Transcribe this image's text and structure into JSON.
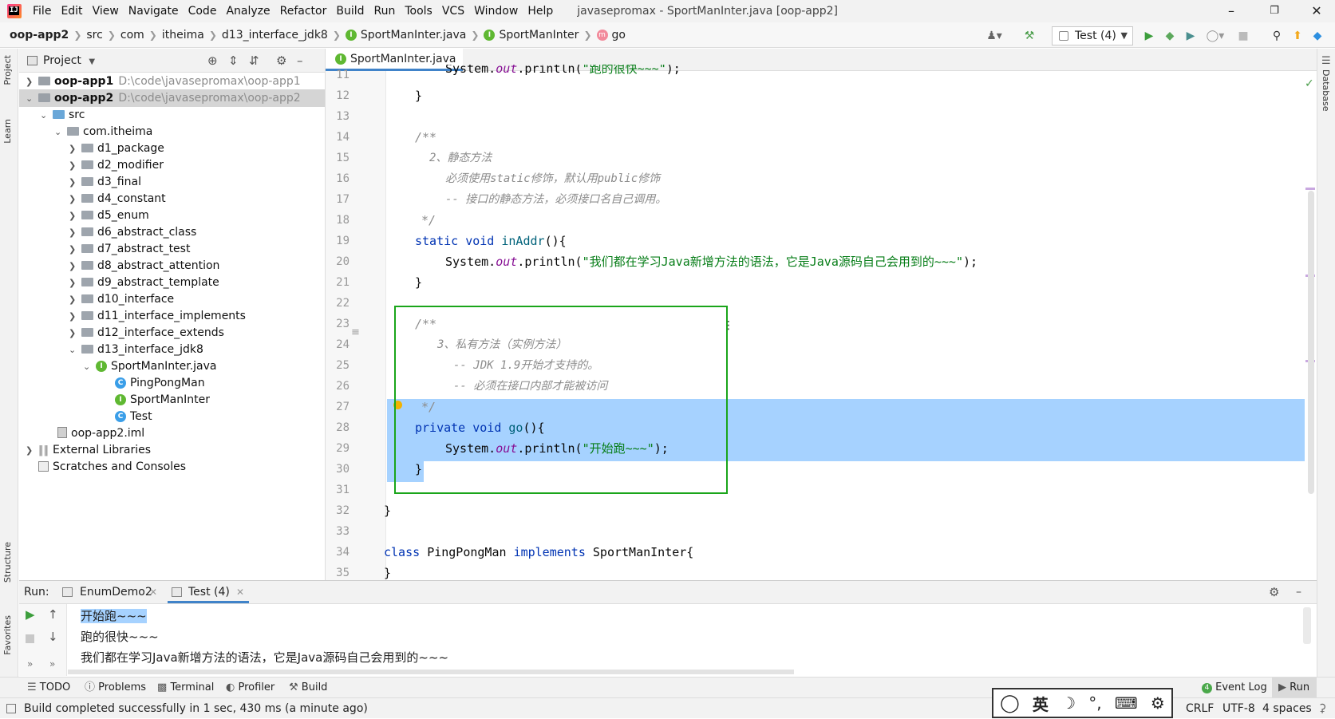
{
  "menubar": {
    "items": [
      "File",
      "Edit",
      "View",
      "Navigate",
      "Code",
      "Analyze",
      "Refactor",
      "Build",
      "Run",
      "Tools",
      "VCS",
      "Window",
      "Help"
    ],
    "title": "javasepromax - SportManInter.java [oop-app2]"
  },
  "navbar": {
    "crumbs": [
      "oop-app2",
      "src",
      "com",
      "itheima",
      "d13_interface_jdk8",
      "SportManInter.java",
      "SportManInter",
      "go"
    ],
    "run_config": "Test (4)"
  },
  "left_strip": {
    "project": "Project",
    "learn": "Learn",
    "structure": "Structure",
    "favorites": "Favorites"
  },
  "right_strip": {
    "database": "Database"
  },
  "project_panel": {
    "title": "Project",
    "nodes": [
      {
        "label": "oop-app1",
        "path": "D:\\code\\javasepromax\\oop-app1"
      },
      {
        "label": "oop-app2",
        "path": "D:\\code\\javasepromax\\oop-app2"
      },
      {
        "label": "src"
      },
      {
        "label": "com.itheima"
      },
      {
        "label": "d1_package"
      },
      {
        "label": "d2_modifier"
      },
      {
        "label": "d3_final"
      },
      {
        "label": "d4_constant"
      },
      {
        "label": "d5_enum"
      },
      {
        "label": "d6_abstract_class"
      },
      {
        "label": "d7_abstract_test"
      },
      {
        "label": "d8_abstract_attention"
      },
      {
        "label": "d9_abstract_template"
      },
      {
        "label": "d10_interface"
      },
      {
        "label": "d11_interface_implements"
      },
      {
        "label": "d12_interface_extends"
      },
      {
        "label": "d13_interface_jdk8"
      },
      {
        "label": "SportManInter.java"
      },
      {
        "label": "PingPongMan"
      },
      {
        "label": "SportManInter"
      },
      {
        "label": "Test"
      },
      {
        "label": "oop-app2.iml"
      },
      {
        "label": "External Libraries"
      },
      {
        "label": "Scratches and Consoles"
      }
    ]
  },
  "editor": {
    "tab": "SportManInter.java",
    "line_numbers": [
      "11",
      "12",
      "13",
      "14",
      "15",
      "16",
      "17",
      "18",
      "19",
      "20",
      "21",
      "22",
      "23",
      "24",
      "25",
      "26",
      "27",
      "28",
      "29",
      "30",
      "31",
      "32",
      "33",
      "34",
      "35"
    ],
    "lines": {
      "l11_a": "System.",
      "l11_b": "out",
      "l11_c": ".println(",
      "l11_d": "\"跑的很快~~~\"",
      "l11_e": ");",
      "l12": "}",
      "l14": "/**",
      "l15": "2、静态方法",
      "l16": "必须使用static修饰，默认用public修饰",
      "l17": "-- 接口的静态方法，必须接口名自己调用。",
      "l18": "*/",
      "l19_a": "static void",
      "l19_b": "inAddr",
      "l19_c": "(){",
      "l20_a": "System.",
      "l20_b": "out",
      "l20_c": ".println(",
      "l20_d": "\"我们都在学习Java新增方法的语法，它是Java源码自己会用到的~~~\"",
      "l20_e": ");",
      "l21": "}",
      "l23": "/**",
      "l24": "3、私有方法（实例方法）",
      "l25": "-- JDK 1.9开始才支持的。",
      "l26": "-- 必须在接口内部才能被访问",
      "l27": "*/",
      "l28_a": "private void",
      "l28_b": "go",
      "l28_c": "(){",
      "l29_a": "System.",
      "l29_b": "out",
      "l29_c": ".println(",
      "l29_d": "\"开始跑~~~\"",
      "l29_e": ");",
      "l30": "}",
      "l32": "}",
      "l34_a": "class",
      "l34_b": "PingPongMan",
      "l34_c": "implements",
      "l34_d": "SportManInter{",
      "l35": "}"
    }
  },
  "run_panel": {
    "label": "Run:",
    "tabs": [
      "EnumDemo2",
      "Test (4)"
    ],
    "output": [
      "开始跑~~~",
      "跑的很快~~~",
      "我们都在学习Java新增方法的语法，它是Java源码自己会用到的~~~"
    ]
  },
  "tool_windows": [
    "TODO",
    "Problems",
    "Terminal",
    "Profiler",
    "Build",
    "Event Log",
    "Run"
  ],
  "event_count": "4",
  "status": {
    "message": "Build completed successfully in 1 sec, 430 ms (a minute ago)",
    "line_sep": "CRLF",
    "encoding": "UTF-8",
    "indent": "4 spaces"
  },
  "ime": {
    "lang": "英"
  }
}
